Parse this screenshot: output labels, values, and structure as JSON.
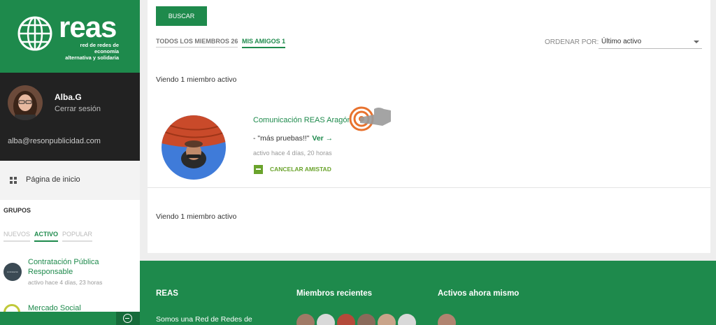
{
  "colors": {
    "brand": "#1e8a4c",
    "accent": "#6aa32c",
    "dark": "#222222"
  },
  "logo": {
    "word": "reas",
    "tagline_1": "red de redes de economía",
    "tagline_2": "alternativa y solidaria"
  },
  "user": {
    "name": "Alba.G",
    "logout": "Cerrar sesión",
    "email": "alba@resonpublicidad.com"
  },
  "nav": {
    "home": "Página de inicio"
  },
  "groups": {
    "heading": "GRUPOS",
    "tabs": [
      "NUEVOS",
      "ACTIVO",
      "POPULAR"
    ],
    "active_tab": "ACTIVO",
    "items": [
      {
        "logo_text": "contratación responsable",
        "title": "Contratación Pública Responsable",
        "meta": "activo hace 4 días, 23 horas"
      },
      {
        "title": "Mercado Social"
      }
    ]
  },
  "search": {
    "button": "BUSCAR"
  },
  "tabs": {
    "all": "TODOS LOS MIEMBROS 26",
    "friends": "MIS AMIGOS 1"
  },
  "order": {
    "label": "ORDENAR POR:",
    "value": "Último activo"
  },
  "viewing_text": "Viendo 1 miembro activo",
  "member": {
    "name": "Comunicación REAS Aragón",
    "update": "- \"más pruebas!!\"",
    "view_link": "Ver →",
    "active": "activo hace 4 días, 20 horas",
    "cancel": "CANCELAR AMISTAD"
  },
  "footer": {
    "col1_title": "REAS",
    "col1_text": "Somos una Red de Redes de",
    "col2_title": "Miembros recientes",
    "col3_title": "Activos ahora mismo",
    "recent_member_count": 6
  }
}
